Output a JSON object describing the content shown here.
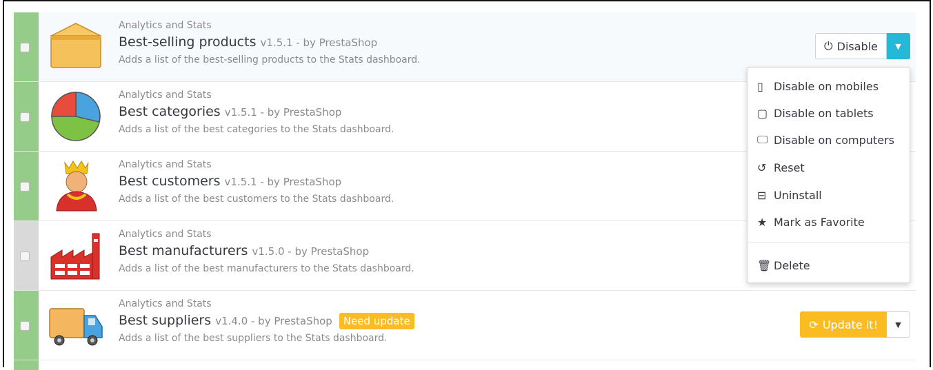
{
  "modules": [
    {
      "category": "Analytics and Stats",
      "name": "Best-selling products",
      "meta": "v1.5.1 - by PrestaShop",
      "description": "Adds a list of the best-selling products to the Stats dashboard.",
      "icon": "open-box-icon",
      "enabled": true
    },
    {
      "category": "Analytics and Stats",
      "name": "Best categories",
      "meta": "v1.5.1 - by PrestaShop",
      "description": "Adds a list of the best categories to the Stats dashboard.",
      "icon": "pie-chart-icon",
      "enabled": true
    },
    {
      "category": "Analytics and Stats",
      "name": "Best customers",
      "meta": "v1.5.1 - by PrestaShop",
      "description": "Adds a list of the best customers to the Stats dashboard.",
      "icon": "crowned-customer-icon",
      "enabled": true
    },
    {
      "category": "Analytics and Stats",
      "name": "Best manufacturers",
      "meta": "v1.5.0 - by PrestaShop",
      "description": "Adds a list of the best manufacturers to the Stats dashboard.",
      "icon": "factory-icon",
      "enabled": false
    },
    {
      "category": "Analytics and Stats",
      "name": "Best suppliers",
      "meta": "v1.4.0 - by PrestaShop",
      "description": "Adds a list of the best suppliers to the Stats dashboard.",
      "badge": "Need update",
      "icon": "delivery-truck-icon",
      "enabled": true
    }
  ],
  "buttons": {
    "disable": "Disable",
    "update": "Update it!"
  },
  "dropdown": {
    "items": [
      "Disable on mobiles",
      "Disable on tablets",
      "Disable on computers",
      "Reset",
      "Uninstall",
      "Mark as Favorite",
      "Delete"
    ]
  },
  "colors": {
    "enabled_strip": "#95cc8a",
    "disabled_strip": "#d9d9d9",
    "primary_blue": "#25b9d7",
    "warning_yellow": "#fbbb22"
  }
}
